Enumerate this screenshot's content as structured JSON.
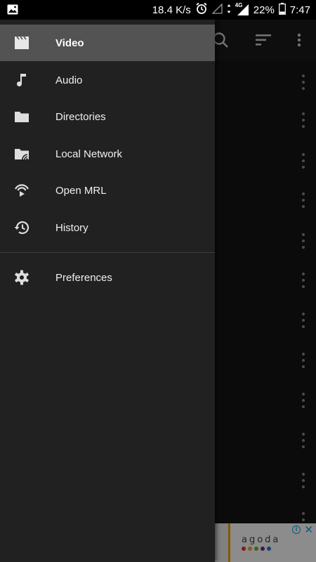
{
  "status_bar": {
    "net_speed": "18.4 K/s",
    "network_type": "4G",
    "battery": "22%",
    "time": "7:47",
    "icons": [
      "image-icon",
      "alarm-icon",
      "signal-empty-icon",
      "data-arrows-icon",
      "signal-4g-icon",
      "battery-icon"
    ]
  },
  "toolbar": {
    "icons": [
      "search-icon",
      "sort-icon",
      "more-vert-icon"
    ]
  },
  "drawer": {
    "items": [
      {
        "label": "Video",
        "icon": "video-clapper-icon",
        "selected": true
      },
      {
        "label": "Audio",
        "icon": "music-note-icon",
        "selected": false
      },
      {
        "label": "Directories",
        "icon": "folder-icon",
        "selected": false
      },
      {
        "label": "Local Network",
        "icon": "network-folder-icon",
        "selected": false
      },
      {
        "label": "Open MRL",
        "icon": "stream-icon",
        "selected": false
      },
      {
        "label": "History",
        "icon": "history-icon",
        "selected": false
      }
    ],
    "footer_items": [
      {
        "label": "Preferences",
        "icon": "gear-icon"
      }
    ]
  },
  "ad": {
    "brand": "agoda",
    "dot_colors": [
      "#e5322d",
      "#f5a623",
      "#7ab51d",
      "#6f2c91",
      "#2a7ad4"
    ],
    "icons": [
      "ad-info-icon",
      "ad-close-icon"
    ]
  },
  "colors": {
    "drawer_bg": "#212121",
    "selected_bg": "#535353",
    "app_bg": "#141414",
    "icon": "#dedede",
    "ad_accent": "#00a6e6"
  }
}
